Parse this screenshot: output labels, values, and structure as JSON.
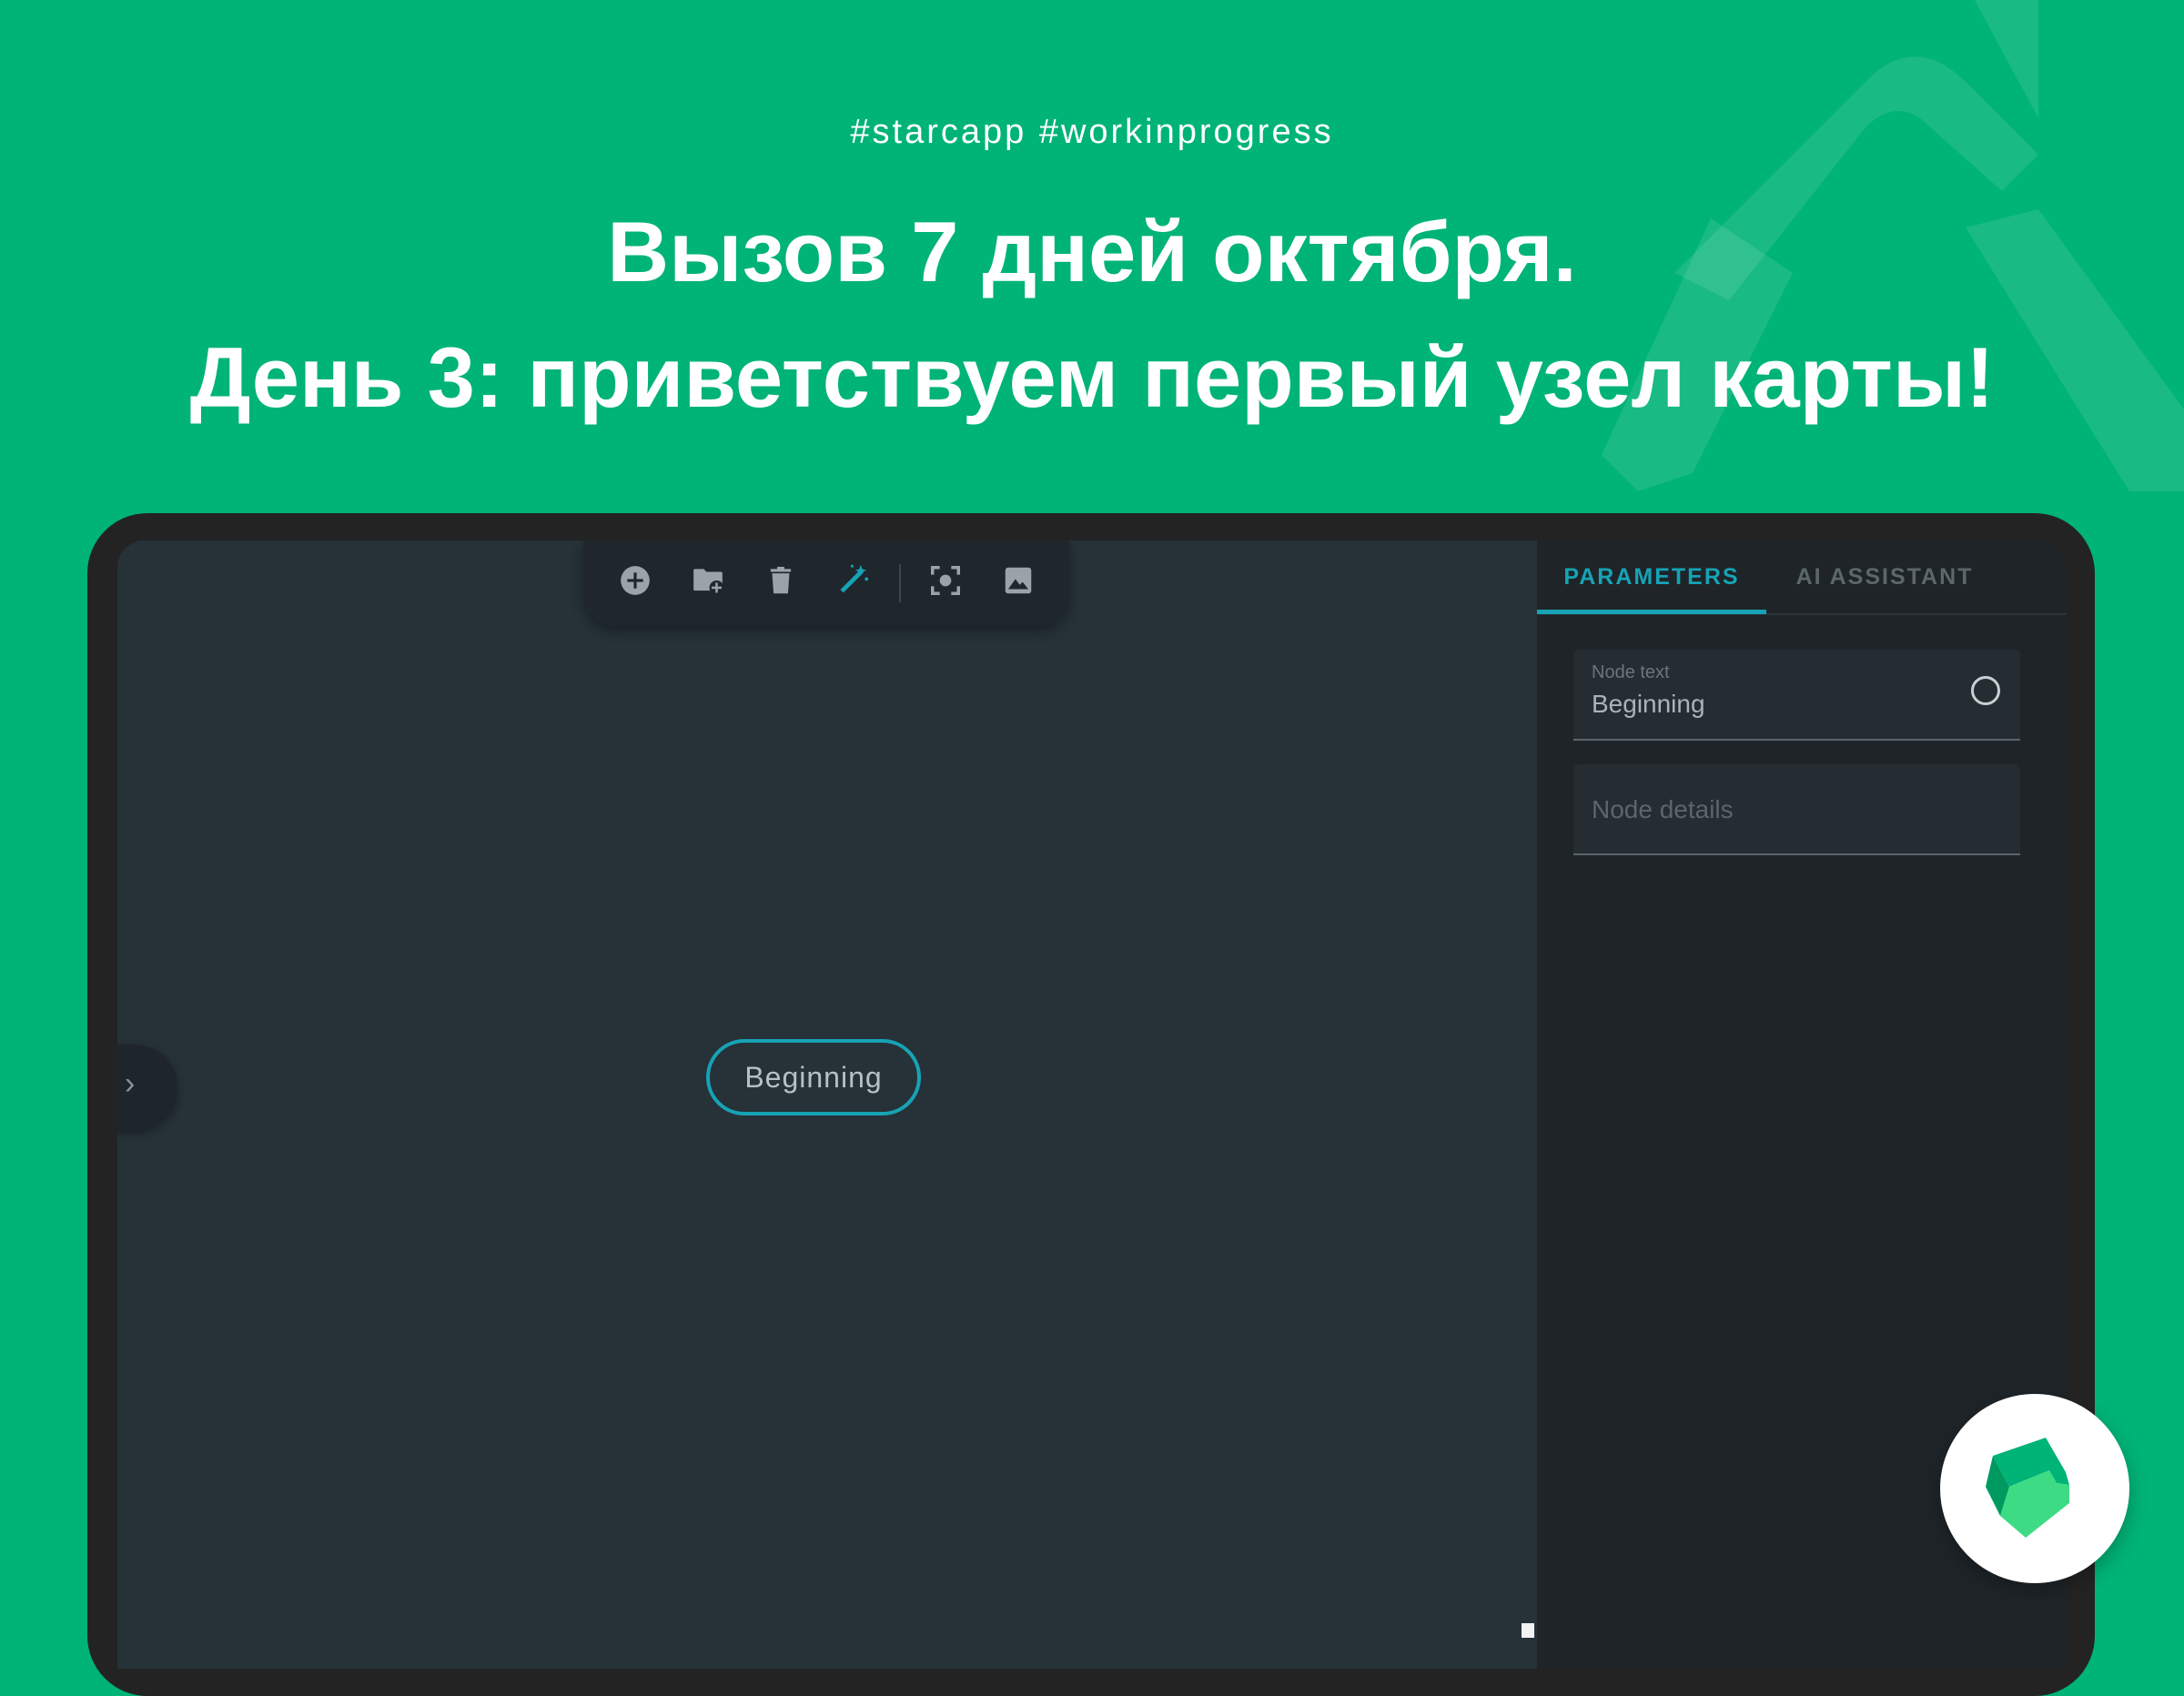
{
  "header": {
    "hashtags": "#starcapp  #workinprogress",
    "title_line1": "Вызов 7 дней октября.",
    "title_line2": "День 3: приветствуем первый узел карты!"
  },
  "toolbar": {
    "tools": [
      {
        "name": "add-node",
        "icon": "plus-circle-icon"
      },
      {
        "name": "add-folder",
        "icon": "folder-plus-icon"
      },
      {
        "name": "delete",
        "icon": "trash-icon"
      },
      {
        "name": "ai-magic",
        "icon": "magic-wand-icon"
      },
      {
        "name": "focus",
        "icon": "focus-center-icon"
      },
      {
        "name": "export-image",
        "icon": "image-icon"
      }
    ]
  },
  "canvas": {
    "node_label": "Beginning",
    "side_toggle": "›"
  },
  "panel": {
    "tabs": [
      {
        "label": "PARAMETERS",
        "active": true
      },
      {
        "label": "AI ASSISTANT",
        "active": false
      }
    ],
    "node_text": {
      "label": "Node text",
      "value": "Beginning"
    },
    "node_details": {
      "placeholder": "Node details"
    }
  },
  "colors": {
    "background": "#00B377",
    "accent": "#16A3B5",
    "canvas": "#263238",
    "panel": "#1E2428"
  }
}
